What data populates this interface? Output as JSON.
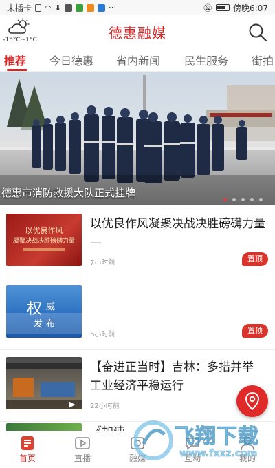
{
  "status_bar": {
    "left": "未插卡",
    "right": "傍晚6:07"
  },
  "header": {
    "title": "德惠融媒",
    "weather_temp": "-15°C~1°C"
  },
  "tabs": [
    {
      "label": "推荐",
      "active": true
    },
    {
      "label": "今日德惠"
    },
    {
      "label": "省内新闻"
    },
    {
      "label": "民生服务"
    },
    {
      "label": "街拍"
    }
  ],
  "banner": {
    "caption": "德惠市消防救援大队正式挂牌",
    "slide_count": 5,
    "active_slide": 1
  },
  "news": [
    {
      "title": "以优良作风凝聚决战决胜磅礴力量—",
      "thumb_text_1": "以优良作风",
      "thumb_text_2": "凝聚决战决胜磅礴力量",
      "time": "7小时前",
      "badge": "置顶"
    },
    {
      "title": "",
      "thumb_text_1": "权",
      "thumb_text_2": "威",
      "thumb_text_3": "发",
      "thumb_text_4": "布",
      "time": "6小时前",
      "badge": "置顶"
    },
    {
      "title": "【奋进正当时】吉林：多措并举 工业经济平稳运行",
      "time": "22小时前",
      "badge": ""
    }
  ],
  "partial_item_title": "《加速",
  "bottom_nav": [
    {
      "label": "首页",
      "icon": "home-icon",
      "active": true
    },
    {
      "label": "直播",
      "icon": "live-icon"
    },
    {
      "label": "融媒",
      "icon": "media-icon"
    },
    {
      "label": "互动",
      "icon": "interact-icon"
    },
    {
      "label": "我的",
      "icon": "profile-icon"
    }
  ],
  "watermark": {
    "text": "飞翔下载",
    "url": "www.fxxz.com"
  },
  "colors": {
    "brand_red": "#d42a2a",
    "badge_red": "#d9342b"
  }
}
